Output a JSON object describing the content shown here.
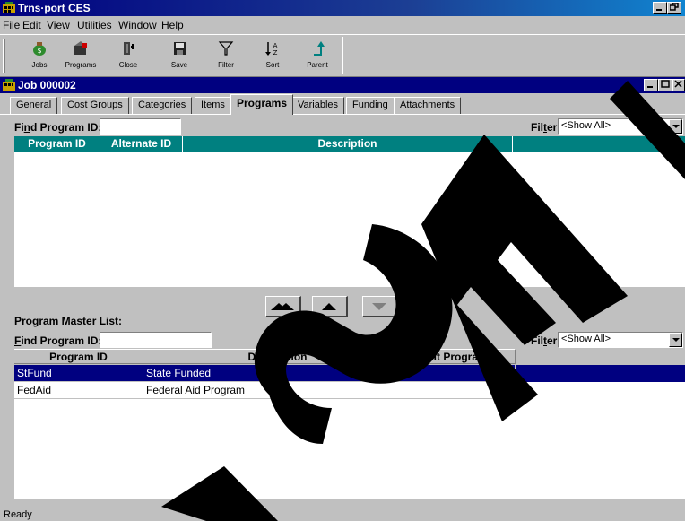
{
  "app": {
    "title": "Trns·port CES",
    "controls": [
      "_",
      "Ѐ",
      ""
    ]
  },
  "menu": [
    {
      "pre": "",
      "u": "F",
      "post": "ile"
    },
    {
      "pre": "",
      "u": "E",
      "post": "dit"
    },
    {
      "pre": "",
      "u": "V",
      "post": "iew"
    },
    {
      "pre": "",
      "u": "U",
      "post": "tilities"
    },
    {
      "pre": "",
      "u": "W",
      "post": "indow"
    },
    {
      "pre": "",
      "u": "H",
      "post": "elp"
    }
  ],
  "toolbar": {
    "jobs": "Jobs",
    "programs": "Programs",
    "close": "Close",
    "save": "Save",
    "filter": "Filter",
    "sort": "Sort",
    "parent": "Parent"
  },
  "window": {
    "title": "Job 000002"
  },
  "tabs": [
    "General",
    "Cost Groups",
    "Categories",
    "Items",
    "Programs",
    "Variables",
    "Funding",
    "Attachments"
  ],
  "active_tab": "Programs",
  "top": {
    "find_label_pre": "Fi",
    "find_label_u": "n",
    "find_label_post": "d Program ID:",
    "find_value": "",
    "filter_label_pre": "Fil",
    "filter_label_u": "t",
    "filter_label_post": "er:",
    "filter_value": "<Show All>",
    "columns": [
      "Program ID",
      "Alternate ID",
      "Description"
    ]
  },
  "master": {
    "heading": "Program Master List:",
    "find_label_pre": "",
    "find_label_u": "F",
    "find_label_post": "ind Program ID:",
    "find_value": "",
    "filter_label_pre": "Fil",
    "filter_label_u": "t",
    "filter_label_post": "er:",
    "filter_value": "<Show All>",
    "columns": [
      "Program ID",
      "Description",
      "Alt Program ID"
    ],
    "rows": [
      {
        "id": "StFund",
        "desc": "State Funded",
        "alt": "",
        "selected": true
      },
      {
        "id": "FedAid",
        "desc": "Federal Aid Program",
        "alt": "",
        "selected": false
      }
    ]
  },
  "status": {
    "text": "Ready"
  },
  "watermark": {
    "text": "RSE",
    "color": "#000000"
  }
}
